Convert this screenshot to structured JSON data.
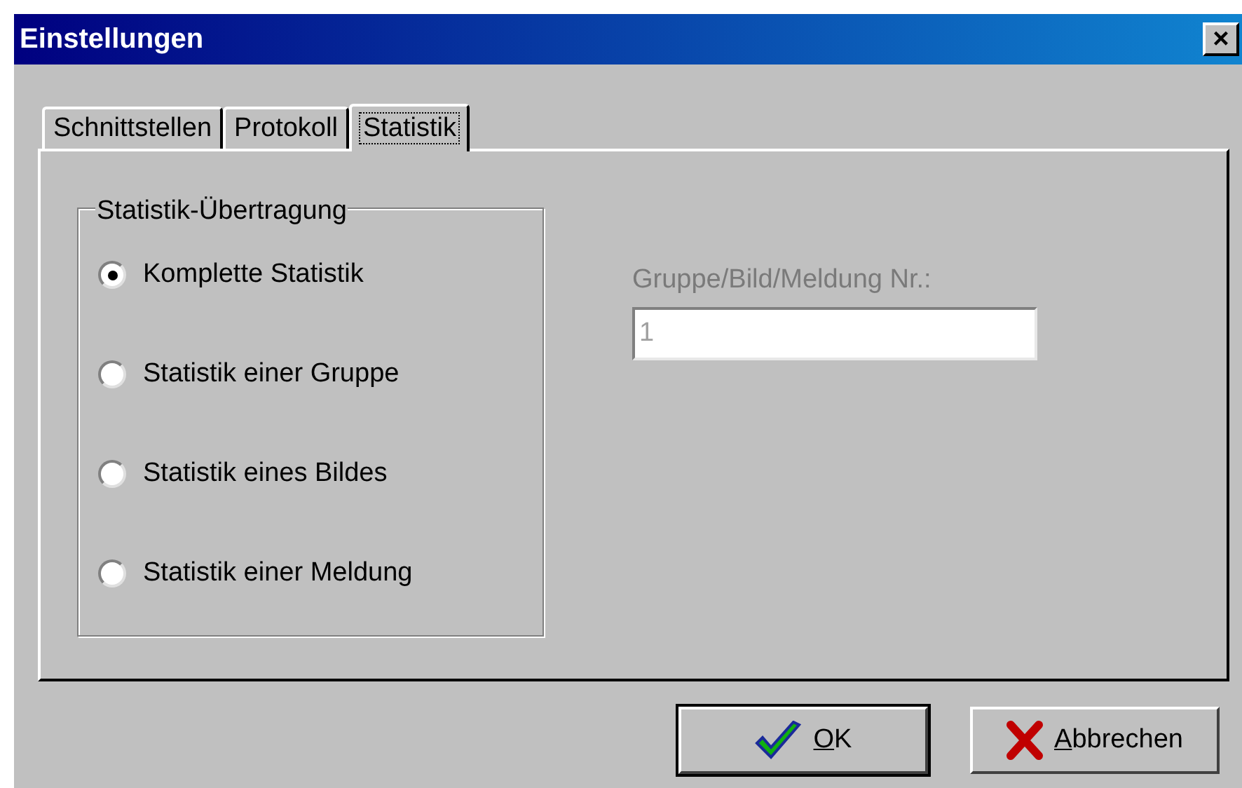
{
  "window": {
    "title": "Einstellungen",
    "close": "×"
  },
  "tabs": [
    {
      "label": "Schnittstellen",
      "selected": false
    },
    {
      "label": "Protokoll",
      "selected": false
    },
    {
      "label": "Statistik",
      "selected": true
    }
  ],
  "group": {
    "title": "Statistik-Übertragung",
    "options": [
      {
        "label": "Komplette Statistik",
        "selected": true
      },
      {
        "label": "Statistik einer Gruppe",
        "selected": false
      },
      {
        "label": "Statistik eines Bildes",
        "selected": false
      },
      {
        "label": "Statistik einer Meldung",
        "selected": false
      }
    ]
  },
  "number_field": {
    "label": "Gruppe/Bild/Meldung Nr.:",
    "value": "1",
    "disabled": true
  },
  "buttons": [
    {
      "label": "OK",
      "kind": "ok",
      "default": true
    },
    {
      "label": "Abbrechen",
      "kind": "cancel",
      "default": false
    }
  ]
}
